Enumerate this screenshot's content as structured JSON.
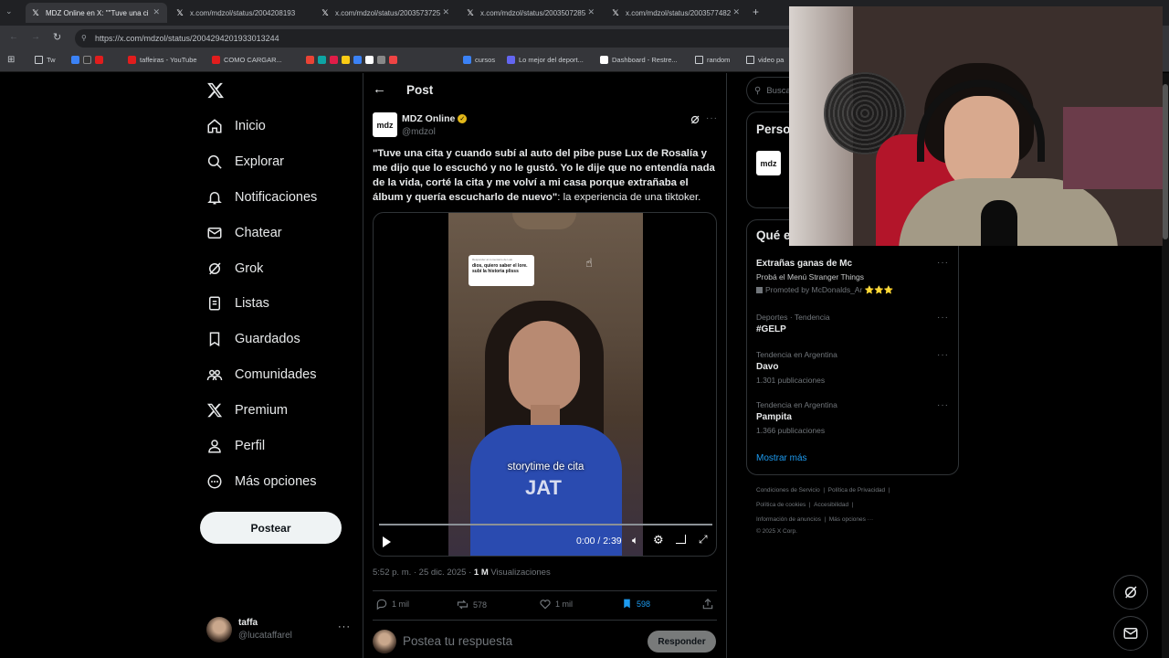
{
  "browser": {
    "tabs": [
      {
        "title": "MDZ Online en X: \"\"Tuve una ci"
      },
      {
        "title": "x.com/mdzol/status/2004208193"
      },
      {
        "title": "x.com/mdzol/status/2003573725"
      },
      {
        "title": "x.com/mdzol/status/2003507285"
      },
      {
        "title": "x.com/mdzol/status/2003577482"
      }
    ],
    "new_tab": "+",
    "url": "https://x.com/mdzol/status/2004294201933013244",
    "bookmarks": [
      "Tw",
      "taffeiras - YouTube",
      "COMO CARGAR...",
      "cursos",
      "Lo mejor del deport...",
      "Dashboard - Restre...",
      "random",
      "video pa"
    ]
  },
  "nav": {
    "items": [
      {
        "label": "Inicio",
        "icon": "home-icon"
      },
      {
        "label": "Explorar",
        "icon": "search-icon"
      },
      {
        "label": "Notificaciones",
        "icon": "bell-icon"
      },
      {
        "label": "Chatear",
        "icon": "mail-icon"
      },
      {
        "label": "Grok",
        "icon": "grok-icon"
      },
      {
        "label": "Listas",
        "icon": "list-icon"
      },
      {
        "label": "Guardados",
        "icon": "bookmark-icon"
      },
      {
        "label": "Comunidades",
        "icon": "communities-icon"
      },
      {
        "label": "Premium",
        "icon": "x-icon"
      },
      {
        "label": "Perfil",
        "icon": "person-icon"
      },
      {
        "label": "Más opciones",
        "icon": "more-circle-icon"
      }
    ],
    "post_button": "Postear",
    "account": {
      "name": "taffa",
      "handle": "@lucataffarel"
    }
  },
  "post": {
    "header_title": "Post",
    "author": "MDZ Online",
    "handle": "@mdzol",
    "avatar_text": "mdz",
    "text_bold": "\"Tuve una cita y cuando subí al auto del pibe puse Lux de Rosalía y me dijo que lo escuchó y no le gustó. Yo le dije que no entendía nada de la vida, corté la cita y me volví a mi casa porque extrañaba el álbum y quería escucharlo de nuevo\"",
    "text_rest": ": la experiencia de una tiktoker.",
    "video": {
      "caption": "storytime de cita",
      "comment_bubble_top": "Responder al comentario de Lalo",
      "comment_bubble_text": "dios, quiero saber el lore. subí la historia plisss",
      "time": "0:00 / 2:39",
      "progress": 0
    },
    "meta_time": "5:52 p. m. · 25 dic. 2025 · ",
    "views_count": "1 M",
    "views_label": " Visualizaciones",
    "stats": {
      "replies": "1 mil",
      "reposts": "578",
      "likes": "1 mil",
      "bookmarks": "598"
    },
    "reply_placeholder": "Postea tu respuesta",
    "reply_button": "Responder"
  },
  "right": {
    "search_placeholder": "Busca",
    "people_title": "Perso",
    "trends_title": "Qué e",
    "trends": [
      {
        "context": "",
        "title": "Extrañas ganas de Mc",
        "sub": "Probá el Menú Stranger Things",
        "promo": "Promoted by McDonalds_Ar ⭐⭐⭐"
      },
      {
        "context": "Deportes · Tendencia",
        "title": "#GELP",
        "sub": "",
        "promo": ""
      },
      {
        "context": "Tendencia en Argentina",
        "title": "Davo",
        "sub": "1.301 publicaciones",
        "promo": ""
      },
      {
        "context": "Tendencia en Argentina",
        "title": "Pampita",
        "sub": "1.366 publicaciones",
        "promo": ""
      }
    ],
    "show_more": "Mostrar más",
    "footer": [
      "Condiciones de Servicio",
      "Política de Privacidad",
      "Política de cookies",
      "Accesibilidad",
      "Información de anuncios",
      "Más opciones ···",
      "© 2025 X Corp."
    ]
  },
  "colors": {
    "accent": "#1d9bf0",
    "verified": "#e2b719",
    "bookmarked": "#1d9bf0"
  }
}
